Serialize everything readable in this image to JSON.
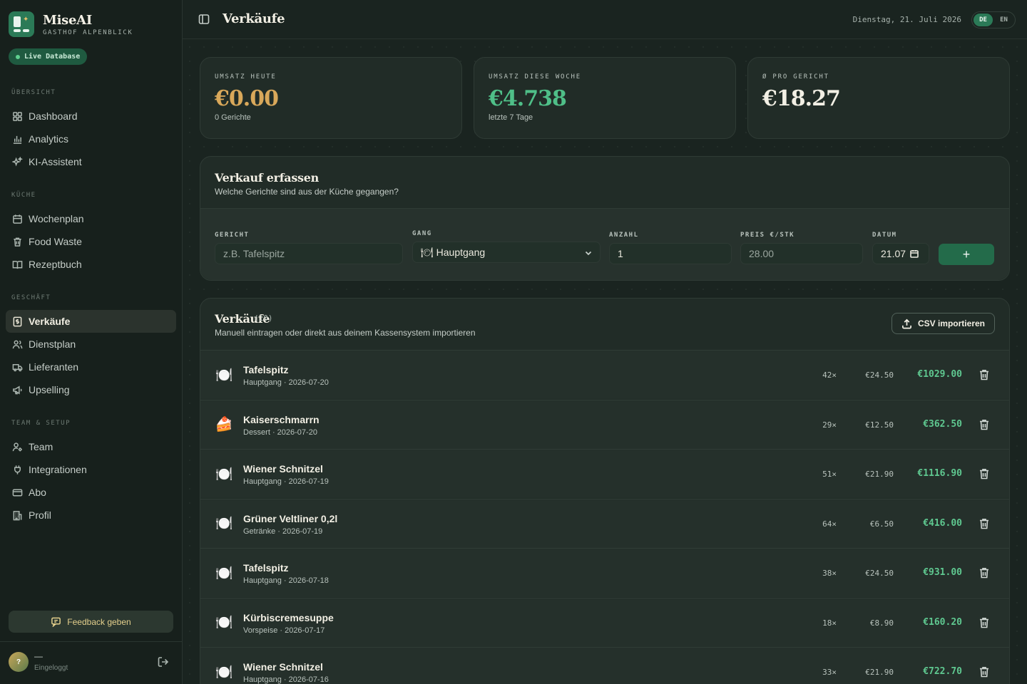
{
  "brand": {
    "name": "MiseAI",
    "subtitle": "GASTHOF ALPENBLICK"
  },
  "live_badge": "Live Database",
  "nav": {
    "section_overview": "ÜBERSICHT",
    "section_kitchen": "KÜCHE",
    "section_business": "GESCHÄFT",
    "section_team": "TEAM & SETUP",
    "dashboard": "Dashboard",
    "analytics": "Analytics",
    "assistant": "KI-Assistent",
    "weekplan": "Wochenplan",
    "foodwaste": "Food Waste",
    "recipes": "Rezeptbuch",
    "sales": "Verkäufe",
    "roster": "Dienstplan",
    "suppliers": "Lieferanten",
    "upselling": "Upselling",
    "team": "Team",
    "integrations": "Integrationen",
    "subscription": "Abo",
    "profile": "Profil"
  },
  "feedback_label": "Feedback geben",
  "user": {
    "avatar": "?",
    "name": "—",
    "status": "Eingeloggt"
  },
  "header": {
    "title": "Verkäufe",
    "date": "Dienstag, 21. Juli 2026",
    "lang_de": "DE",
    "lang_en": "EN"
  },
  "stats": [
    {
      "label": "UMSATZ HEUTE",
      "value": "€0.00",
      "sub": "0 Gerichte",
      "color": "#d9a85a"
    },
    {
      "label": "UMSATZ DIESE WOCHE",
      "value": "€4.738",
      "sub": "letzte 7 Tage",
      "color": "#4fbf88"
    },
    {
      "label": "Ø PRO GERICHT",
      "value": "€18.27",
      "sub": "",
      "color": "#f2efe4"
    }
  ],
  "form": {
    "title": "Verkauf erfassen",
    "subtitle": "Welche Gerichte sind aus der Küche gegangen?",
    "dish_label": "GERICHT",
    "dish_placeholder": "z.B. Tafelspitz",
    "course_label": "GANG",
    "course_value": "🍽 Hauptgang",
    "qty_label": "ANZAHL",
    "qty_value": "1",
    "price_label": "PREIS €/STK",
    "price_value": "28.00",
    "date_label": "DATUM",
    "date_value": "21.07",
    "add_label": "+"
  },
  "list": {
    "title": "Verkäufe",
    "count": "(10)",
    "subtitle": "Manuell eintragen oder direkt aus deinem Kassensystem importieren",
    "csv_label": "CSV importieren",
    "rows": [
      {
        "emoji": "🍽️",
        "name": "Tafelspitz",
        "meta": "Hauptgang · 2026-07-20",
        "qty": "42×",
        "price": "€24.50",
        "total": "€1029.00"
      },
      {
        "emoji": "🍰",
        "name": "Kaiserschmarrn",
        "meta": "Dessert · 2026-07-20",
        "qty": "29×",
        "price": "€12.50",
        "total": "€362.50"
      },
      {
        "emoji": "🍽️",
        "name": "Wiener Schnitzel",
        "meta": "Hauptgang · 2026-07-19",
        "qty": "51×",
        "price": "€21.90",
        "total": "€1116.90"
      },
      {
        "emoji": "🍽️",
        "name": "Grüner Veltliner 0,2l",
        "meta": "Getränke · 2026-07-19",
        "qty": "64×",
        "price": "€6.50",
        "total": "€416.00"
      },
      {
        "emoji": "🍽️",
        "name": "Tafelspitz",
        "meta": "Hauptgang · 2026-07-18",
        "qty": "38×",
        "price": "€24.50",
        "total": "€931.00"
      },
      {
        "emoji": "🍽️",
        "name": "Kürbiscremesuppe",
        "meta": "Vorspeise · 2026-07-17",
        "qty": "18×",
        "price": "€8.90",
        "total": "€160.20"
      },
      {
        "emoji": "🍽️",
        "name": "Wiener Schnitzel",
        "meta": "Hauptgang · 2026-07-16",
        "qty": "33×",
        "price": "€21.90",
        "total": "€722.70"
      }
    ]
  },
  "colors": {
    "accent": "#2b7a57",
    "positive": "#5fc890",
    "gold": "#d9a85a"
  }
}
